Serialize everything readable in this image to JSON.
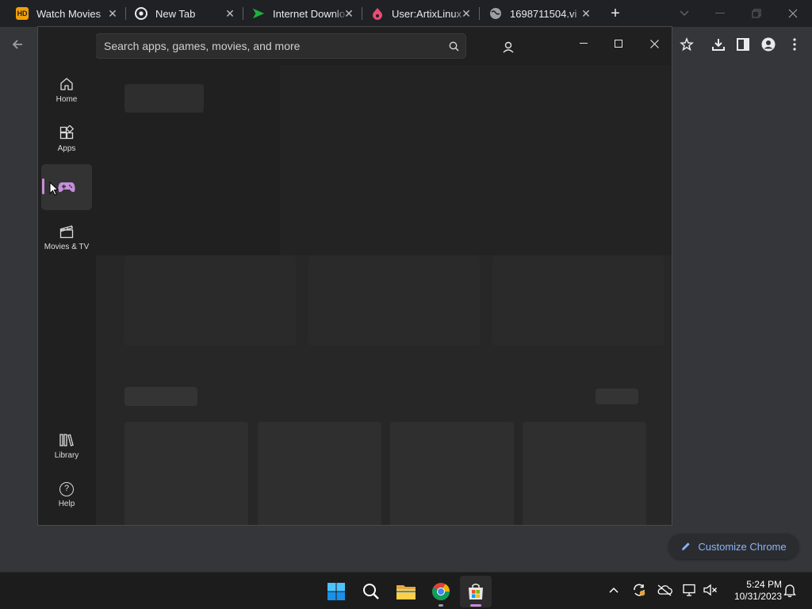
{
  "browser": {
    "tabs": [
      {
        "title": "Watch Movies",
        "favicon": "hd-icon"
      },
      {
        "title": "New Tab",
        "favicon": "chrome-icon"
      },
      {
        "title": "Internet Downlo",
        "favicon": "idm-icon"
      },
      {
        "title": "User:ArtixLinux",
        "favicon": "artix-icon"
      },
      {
        "title": "1698711504.vi",
        "favicon": "globe-icon"
      }
    ],
    "hd_badge": "HD",
    "customize_label": "Customize Chrome"
  },
  "store": {
    "search_placeholder": "Search apps, games, movies, and more",
    "nav": [
      {
        "label": "Home",
        "icon": "home-icon"
      },
      {
        "label": "Apps",
        "icon": "apps-icon"
      },
      {
        "label": "",
        "icon": "gamepad-icon",
        "active": true
      },
      {
        "label": "Movies & TV",
        "icon": "film-icon"
      }
    ],
    "nav_bottom": [
      {
        "label": "Library",
        "icon": "library-icon"
      },
      {
        "label": "Help",
        "icon": "help-icon"
      }
    ],
    "help_glyph": "?",
    "accent": "#c68dd9"
  },
  "taskbar": {
    "time": "5:24 PM",
    "date": "10/31/2023"
  }
}
